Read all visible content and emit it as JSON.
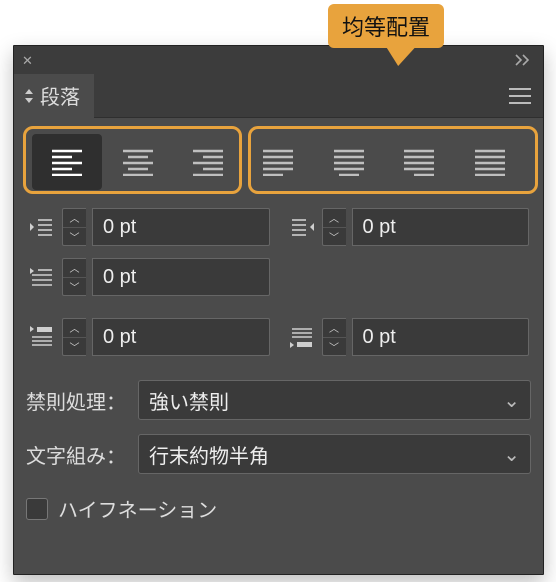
{
  "annotation": {
    "callout_label": "均等配置"
  },
  "panel": {
    "tab_title": "段落"
  },
  "indent": {
    "left": "0 pt",
    "right": "0 pt",
    "first_line": "0 pt",
    "space_before": "0 pt",
    "space_after": "0 pt"
  },
  "kinsoku": {
    "label": "禁則処理：",
    "value": "強い禁則"
  },
  "mojikumi": {
    "label": "文字組み：",
    "value": "行末約物半角"
  },
  "hyphenation": {
    "label": "ハイフネーション",
    "checked": false
  }
}
